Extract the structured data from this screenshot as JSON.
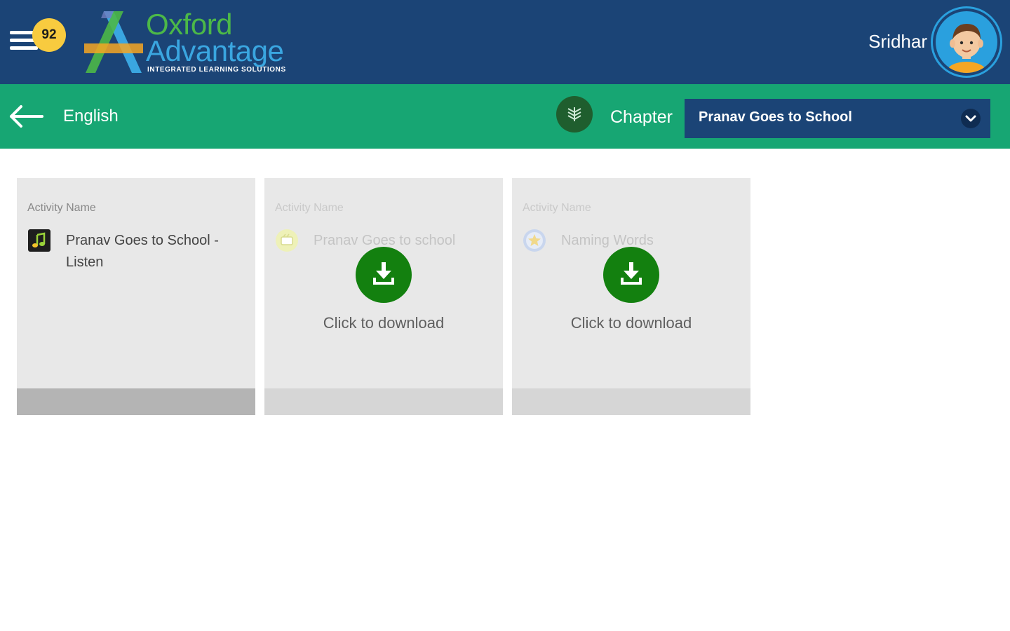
{
  "header": {
    "notification_count": "92",
    "logo": {
      "line1": "Oxford",
      "line2": "Advantage",
      "tagline": "INTEGRATED LEARNING SOLUTIONS"
    },
    "user_name": "Sridhar"
  },
  "subheader": {
    "subject": "English",
    "chapter_label": "Chapter",
    "chapter_selected": "Pranav Goes to School"
  },
  "activities": [
    {
      "label": "Activity Name",
      "name": "Pranav Goes to School - Listen",
      "icon": "music-note-icon",
      "downloaded": true
    },
    {
      "label": "Activity Name",
      "name": "Pranav Goes to school",
      "icon": "video-icon",
      "downloaded": false,
      "download_text": "Click to download"
    },
    {
      "label": "Activity Name",
      "name": "Naming Words",
      "icon": "star-badge-icon",
      "downloaded": false,
      "download_text": "Click to download"
    }
  ],
  "colors": {
    "header_bg": "#1b4476",
    "subheader_bg": "#17a673",
    "download_button": "#13800f",
    "badge": "#f8cb3f"
  }
}
